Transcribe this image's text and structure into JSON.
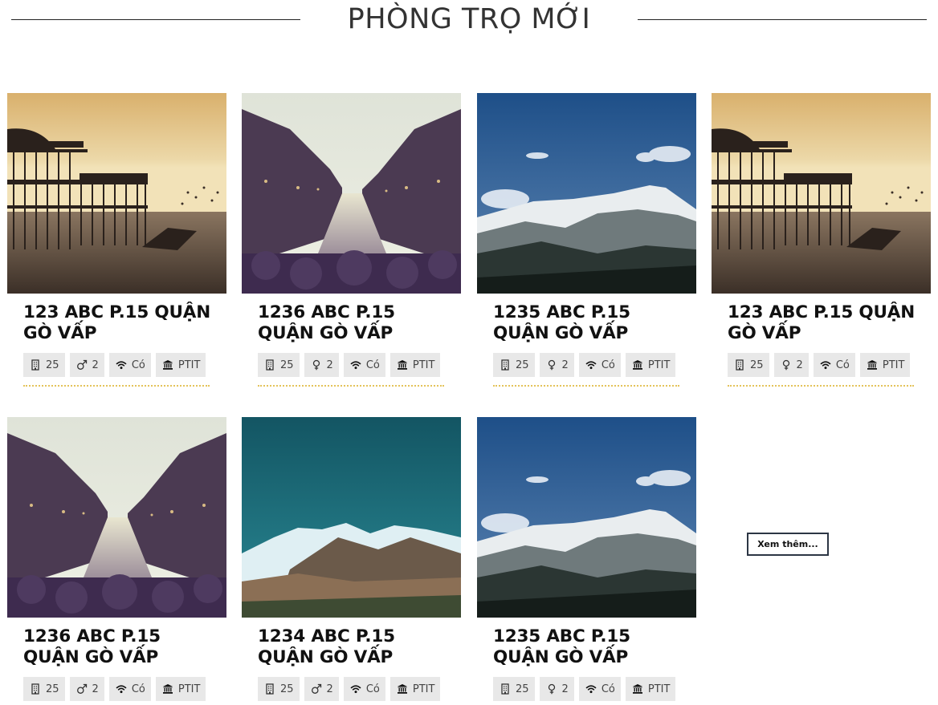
{
  "section": {
    "title": "PHÒNG TRỌ MỚI"
  },
  "listings": [
    {
      "title": "123 ABC P.15 QUẬN GÒ VẤP",
      "photo": "pier-sunset",
      "area": "25",
      "gender": "male",
      "gender_count": "2",
      "wifi": "Có",
      "school": "PTIT"
    },
    {
      "title": "1236 ABC P.15 QUẬN GÒ VẤP",
      "photo": "canal-city",
      "area": "25",
      "gender": "female",
      "gender_count": "2",
      "wifi": "Có",
      "school": "PTIT"
    },
    {
      "title": "1235 ABC P.15 QUẬN GÒ VẤP",
      "photo": "snowy-mountain",
      "area": "25",
      "gender": "female",
      "gender_count": "2",
      "wifi": "Có",
      "school": "PTIT"
    },
    {
      "title": "123 ABC P.15 QUẬN GÒ VẤP",
      "photo": "pier-sunset",
      "area": "25",
      "gender": "female",
      "gender_count": "2",
      "wifi": "Có",
      "school": "PTIT"
    },
    {
      "title": "1236 ABC P.15 QUẬN GÒ VẤP",
      "photo": "canal-city",
      "area": "25",
      "gender": "male",
      "gender_count": "2",
      "wifi": "Có",
      "school": "PTIT"
    },
    {
      "title": "1234 ABC P.15 QUẬN GÒ VẤP",
      "photo": "teal-mountain",
      "area": "25",
      "gender": "male",
      "gender_count": "2",
      "wifi": "Có",
      "school": "PTIT"
    },
    {
      "title": "1235 ABC P.15 QUẬN GÒ VẤP",
      "photo": "snowy-mountain",
      "area": "25",
      "gender": "female",
      "gender_count": "2",
      "wifi": "Có",
      "school": "PTIT"
    }
  ],
  "actions": {
    "more_label": "Xem thêm..."
  },
  "colors": {
    "divider": "#e4c35a",
    "spec_bg": "#e8e8e8",
    "button_border": "#2c3644"
  }
}
